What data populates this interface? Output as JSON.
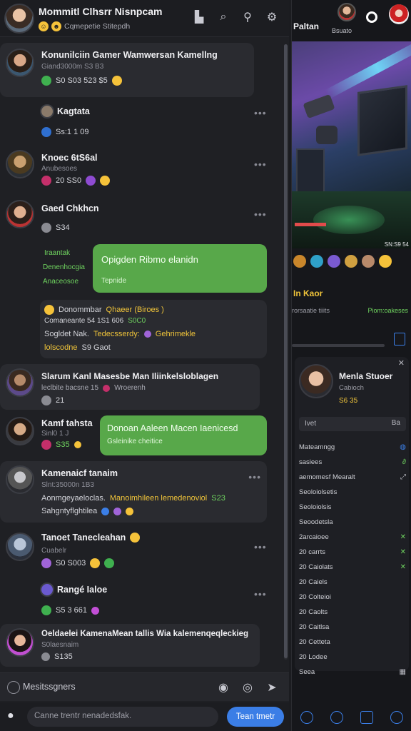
{
  "header": {
    "title": "Mommitl Clhsrr Nisnpcam",
    "subtitle": "Cqmepetie Stitepdh"
  },
  "messages": [
    {
      "name": "Konunilciin Gamer Wamwersan Kamellng",
      "meta": "Giand3000m  S3 B3",
      "reacts": "S0 S03   523  $5"
    },
    {
      "name": "Kagtata",
      "meta": "Ss:1 1 09"
    },
    {
      "name": "Knoec 6tS6al",
      "meta": "Anubesoes",
      "reacts": "20 SS0"
    },
    {
      "name": "Gaed Chkhcn",
      "meta": "S34"
    },
    {
      "name": "Slarum Kanl Masesbe Man Iliinkelsloblagen",
      "meta": "leclbite bacsne 15",
      "extra": "Wroerenh",
      "reacts": "21"
    },
    {
      "name": "Kamf tahsta",
      "meta": "Sinl0 1 J",
      "reacts": "S35"
    },
    {
      "name": "Kamenaicf tanaim",
      "meta": "Slnt:35000n  1B3",
      "line1": "Aonmgeyaeloclas.",
      "line1b": "Manoimhileen lemedenoviol",
      "line1c": "S23",
      "line2": "Sahgntyflghtilea"
    },
    {
      "name": "Tanoet Tanecleahan",
      "meta": "Cuabelr",
      "reacts": "S0 S003"
    },
    {
      "name": "Rangé Ialoe",
      "meta": "S5 3 661"
    },
    {
      "name": "Oeldaelei KamenaMean tallis Wia kalemenqeqleckieg",
      "meta": "S0laesnaim",
      "reacts": "S135"
    }
  ],
  "bubbles": {
    "b1": {
      "title": "Opigden Ribmo elanidn",
      "sub": "Tepnide"
    },
    "b1_side": {
      "title": "Iraantak",
      "l1": "Denenhocgia",
      "l2": "Anaceosoe"
    },
    "b2": {
      "title": "Donoan Aaleen Macen Iaenicesd",
      "sub": "Gsleinike cheitice"
    }
  },
  "system_card": {
    "l1": "Donommbar",
    "l1b": "Qhaeer (Biroes )",
    "l2": "Comaneante 54  1S1 606",
    "l2b": "S0C0",
    "l3": "Sogldet Nak.",
    "l3b": "Tedecsserdy:",
    "l3c": "Gehrimekle",
    "l4": "lolscodne",
    "l4b": "S9 Gaot"
  },
  "composer": {
    "placeholder": "Mesitssgners"
  },
  "bottom_bar": {
    "placeholder": "Canne trentr nenadedsfak.",
    "send_label": "Tean tmetr"
  },
  "right": {
    "label": "Paltan",
    "user": "Bsuato",
    "hud": "SN:S9 54",
    "section_title": "In Kaor",
    "section_left": "rorsaatie tiiits",
    "section_right": "Piom:oakeses",
    "profile": {
      "name": "Menla Stuoer",
      "sub": "Cabioch",
      "stat": "S6 35",
      "search": "Ivet",
      "search_r": "Ba"
    },
    "list": [
      {
        "label": "Mateamngg"
      },
      {
        "label": "sasiees"
      },
      {
        "label": "aemomesf Mearalt"
      },
      {
        "label": "Seoloiolsetis"
      },
      {
        "label": "Seoloiolsis"
      },
      {
        "label": "Seoodetsla"
      },
      {
        "label": "2arcaioee"
      },
      {
        "label": "20 carrts"
      },
      {
        "label": "20 Caiolats"
      },
      {
        "label": "20 Caiels"
      },
      {
        "label": "20 Colteioi"
      },
      {
        "label": "20 Caolts"
      },
      {
        "label": "20 Caitlsa"
      },
      {
        "label": "20 Cetteta"
      },
      {
        "label": "20 Lodee"
      },
      {
        "label": "Seea"
      }
    ]
  },
  "colors": {
    "accent_green": "#58a84a",
    "accent_blue": "#3b7ee6",
    "accent_yellow": "#f0c43a"
  }
}
